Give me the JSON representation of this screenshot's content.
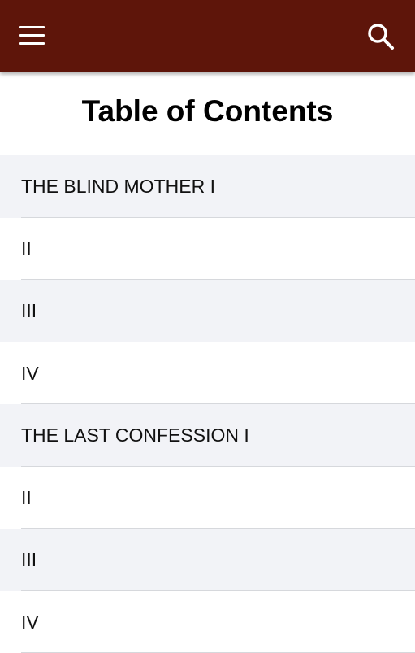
{
  "app_bar": {
    "background_color": "#5e150a",
    "menu_icon": "hamburger-menu-icon",
    "search_icon": "search-icon"
  },
  "page": {
    "title": "Table of Contents"
  },
  "toc": {
    "items": [
      {
        "label": "THE BLIND MOTHER I"
      },
      {
        "label": "II"
      },
      {
        "label": "III"
      },
      {
        "label": "IV"
      },
      {
        "label": "THE LAST CONFESSION I"
      },
      {
        "label": "II"
      },
      {
        "label": "III"
      },
      {
        "label": "IV"
      }
    ]
  }
}
